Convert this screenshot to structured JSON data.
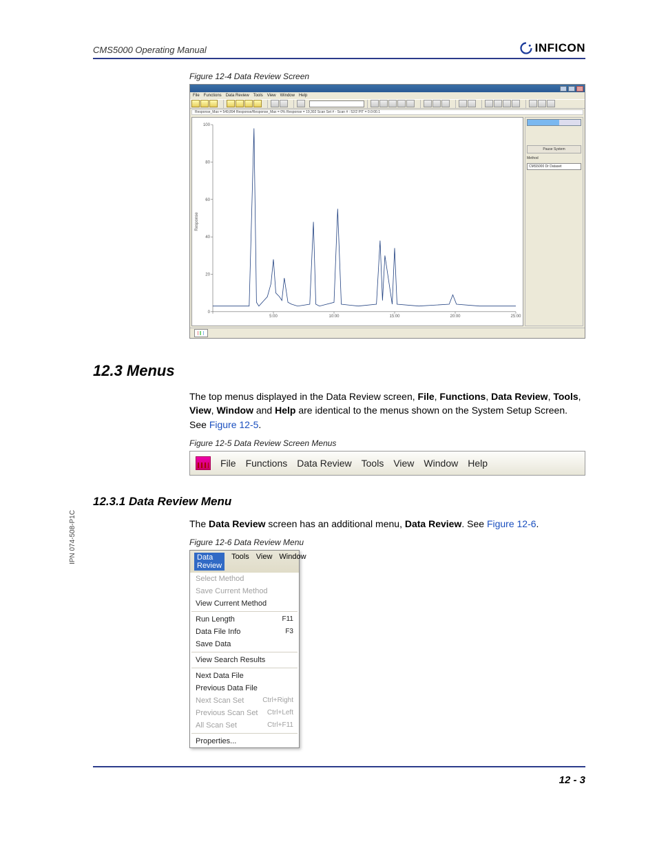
{
  "header": {
    "doc_title": "CMS5000 Operating Manual",
    "brand": "INFICON"
  },
  "ipn": "IPN 074-508-P1C",
  "fig124": {
    "caption": "Figure 12-4  Data Review Screen",
    "menus": [
      "File",
      "Functions",
      "Data Review",
      "Tools",
      "View",
      "Window",
      "Help"
    ],
    "status": "Response_Max = 549,894   Response/Response_Max = 0%   Response = 19,302   Scan Set # - Scan # :   52/2   PIT = 0.0:00.1",
    "side": {
      "pause": "Pause System",
      "method_label": "Method",
      "method_value": "CMS5000 Dr Dataset"
    }
  },
  "section123": {
    "title": "12.3  Menus",
    "text_pre": "The top menus displayed in the Data Review screen, ",
    "b1": "File",
    "c1": ", ",
    "b2": "Functions",
    "c2": ", ",
    "b3": "Data Review",
    "c3": ", ",
    "b4": "Tools",
    "c4": ", ",
    "b5": "View",
    "c5": ", ",
    "b6": "Window",
    "c6": " and ",
    "b7": "Help",
    "text_post": " are identical to the menus shown on the System Setup Screen. See ",
    "link": "Figure 12-5",
    "period": "."
  },
  "fig125": {
    "caption": "Figure 12-5  Data Review Screen Menus",
    "items": [
      "File",
      "Functions",
      "Data Review",
      "Tools",
      "View",
      "Window",
      "Help"
    ]
  },
  "section1231": {
    "title": "12.3.1  Data Review Menu",
    "text_pre": "The ",
    "b1": "Data Review",
    "text_mid": " screen has an additional menu, ",
    "b2": "Data Review",
    "text_post": ". See ",
    "link": "Figure 12-6",
    "period": "."
  },
  "fig126": {
    "caption": "Figure 12-6  Data Review Menu",
    "head": {
      "sel": "Data Review",
      "m1": "Tools",
      "m2": "View",
      "m3": "Window"
    },
    "items": [
      {
        "label": "Select Method",
        "shortcut": "",
        "disabled": true
      },
      {
        "label": "Save Current Method",
        "shortcut": "",
        "disabled": true
      },
      {
        "label": "View Current Method",
        "shortcut": "",
        "disabled": false
      },
      {
        "sep": true
      },
      {
        "label": "Run Length",
        "shortcut": "F11",
        "disabled": false
      },
      {
        "label": "Data File Info",
        "shortcut": "F3",
        "disabled": false
      },
      {
        "label": "Save Data",
        "shortcut": "",
        "disabled": false
      },
      {
        "sep": true
      },
      {
        "label": "View Search Results",
        "shortcut": "",
        "disabled": false
      },
      {
        "sep": true
      },
      {
        "label": "Next Data File",
        "shortcut": "",
        "disabled": false
      },
      {
        "label": "Previous Data File",
        "shortcut": "",
        "disabled": false
      },
      {
        "label": "Next Scan Set",
        "shortcut": "Ctrl+Right",
        "disabled": true
      },
      {
        "label": "Previous Scan Set",
        "shortcut": "Ctrl+Left",
        "disabled": true
      },
      {
        "label": "All Scan Set",
        "shortcut": "Ctrl+F11",
        "disabled": true
      },
      {
        "sep": true
      },
      {
        "label": "Properties...",
        "shortcut": "",
        "disabled": false
      }
    ]
  },
  "page_number": "12 - 3",
  "chart_data": {
    "type": "line",
    "title": "",
    "xlabel": "",
    "ylabel": "Response",
    "xlim": [
      0,
      25
    ],
    "ylim": [
      0,
      100
    ],
    "x_ticks": [
      0,
      5,
      10,
      15,
      20,
      25
    ],
    "y_ticks": [
      0,
      20,
      40,
      60,
      80,
      100
    ],
    "series": [
      {
        "name": "Response",
        "x": [
          0,
          3.0,
          3.4,
          3.6,
          3.8,
          4.5,
          4.8,
          5.0,
          5.2,
          5.5,
          5.7,
          5.9,
          6.2,
          6.5,
          7.0,
          8.0,
          8.3,
          8.5,
          8.8,
          10.0,
          10.3,
          10.6,
          12.0,
          13.5,
          13.8,
          14.0,
          14.2,
          14.8,
          15.0,
          15.2,
          17.0,
          19.5,
          19.8,
          20.1,
          22.0,
          25.0
        ],
        "y": [
          3,
          3,
          98,
          5,
          3,
          8,
          15,
          28,
          10,
          8,
          6,
          18,
          5,
          4,
          3,
          4,
          48,
          4,
          3,
          5,
          55,
          4,
          3,
          4,
          38,
          6,
          30,
          4,
          34,
          4,
          3,
          4,
          9,
          4,
          3,
          3
        ]
      }
    ]
  }
}
